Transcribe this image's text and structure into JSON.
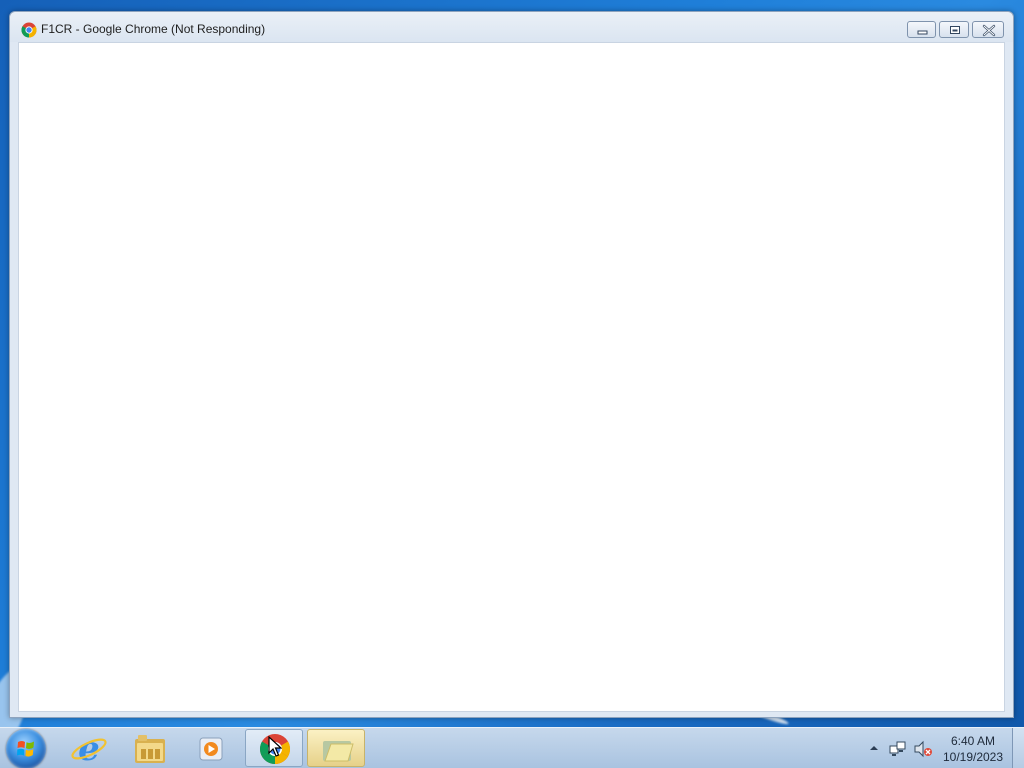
{
  "window": {
    "title": "F1CR - Google Chrome (Not Responding)",
    "app_icon": "chrome-icon",
    "buttons": {
      "minimize": "minimize-icon",
      "maximize": "maximize-icon",
      "close": "close-icon"
    }
  },
  "taskbar": {
    "start_icon": "windows-logo-icon",
    "items": [
      {
        "name": "internet-explorer",
        "icon": "internet-explorer-icon",
        "active": false
      },
      {
        "name": "windows-explorer",
        "icon": "folder-library-icon",
        "active": false
      },
      {
        "name": "windows-media-player",
        "icon": "media-player-icon",
        "active": false
      },
      {
        "name": "google-chrome",
        "icon": "chrome-icon",
        "active": true
      },
      {
        "name": "folder",
        "icon": "folder-icon",
        "active": true,
        "highlighted": true
      }
    ],
    "tray": {
      "show_hidden_icon": "tray-up-arrow-icon",
      "network_icon": "network-icon",
      "volume_icon": "volume-muted-icon",
      "time": "6:40 AM",
      "date": "10/19/2023"
    }
  },
  "colors": {
    "desktop_blue": "#1f7fd9",
    "taskbar": "#b9cfe7",
    "window_frame": "#dfe8f3",
    "client_bg": "#ffffff",
    "folder_highlight": "#f4e29d"
  }
}
